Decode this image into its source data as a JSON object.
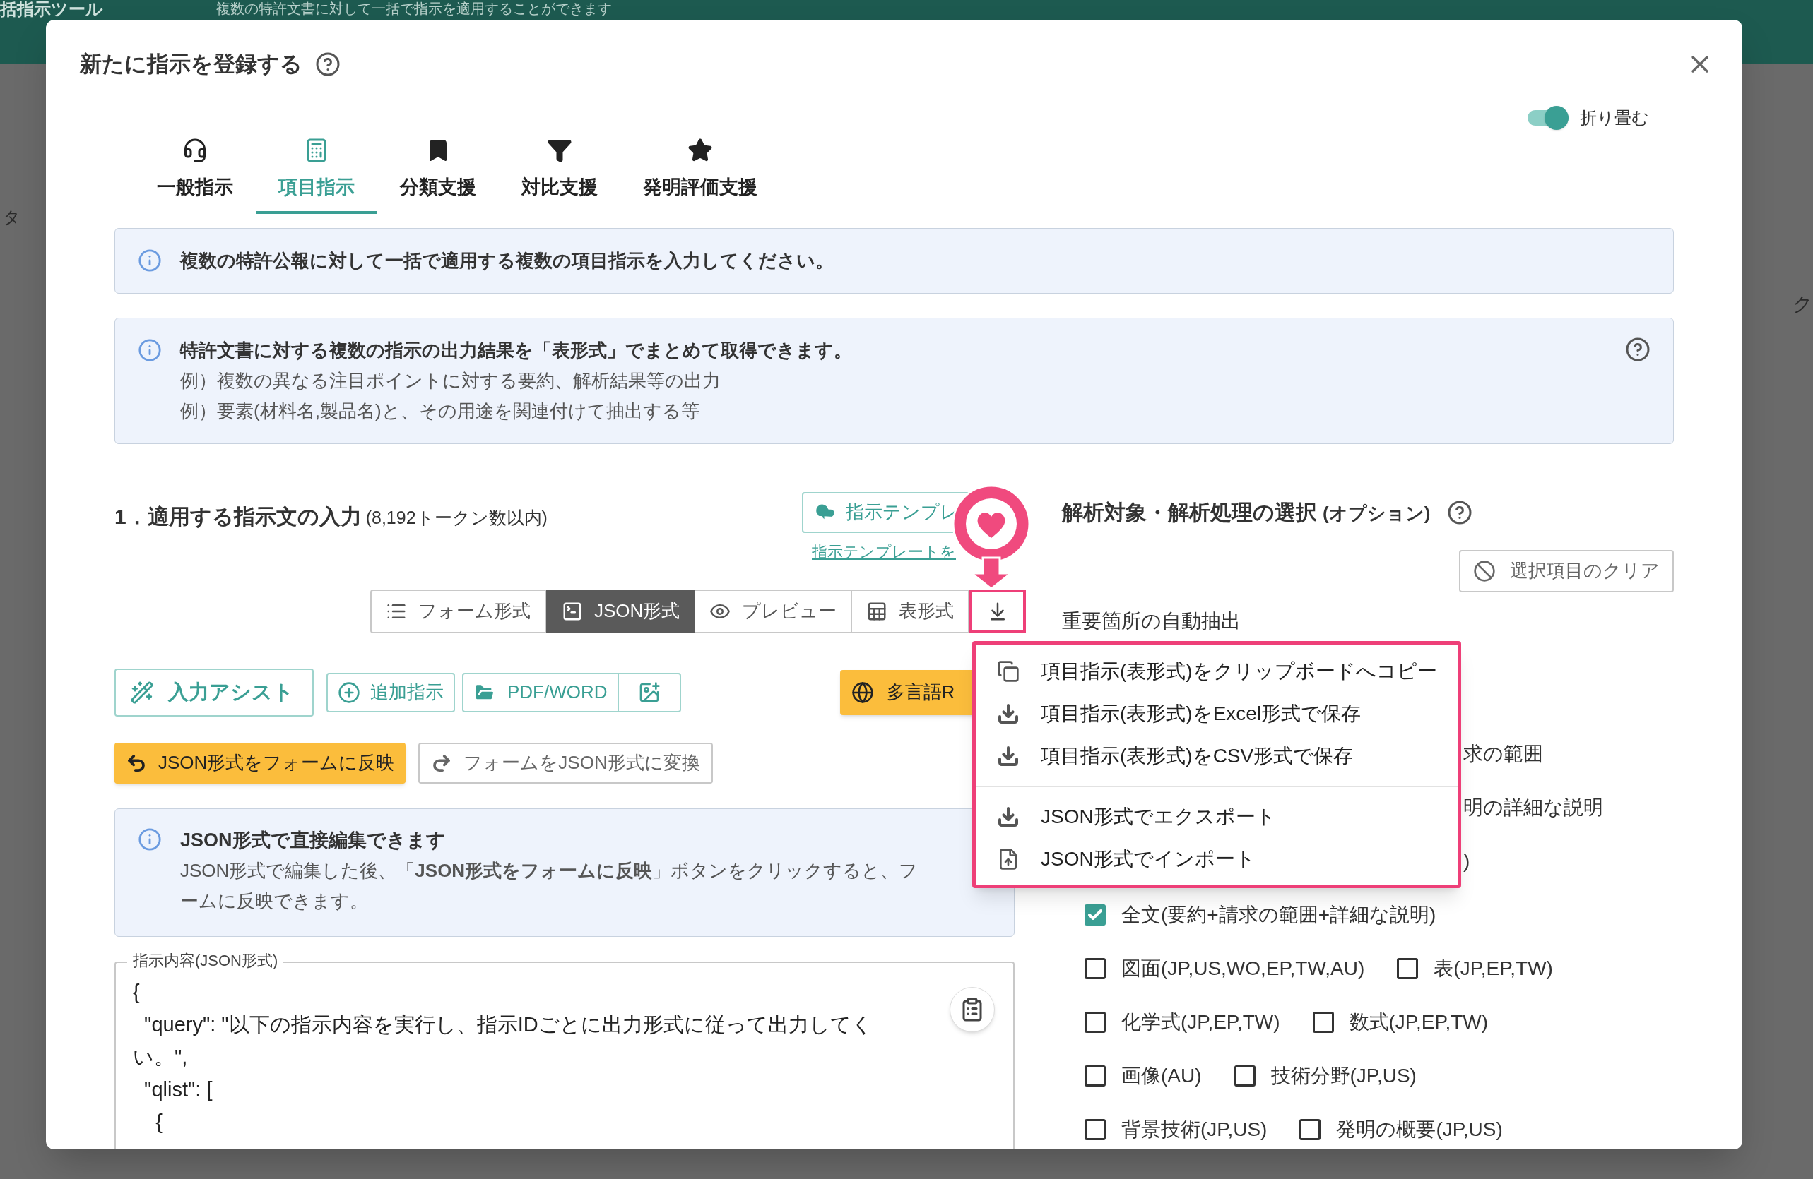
{
  "background": {
    "title": "括指示ツール",
    "subtitle": "複数の特許文書に対して一括で指示を適用することができます",
    "left_label": "タ",
    "right_label": "ク"
  },
  "dialog": {
    "title": "新たに指示を登録する",
    "collapse": {
      "label": "折り畳む",
      "on": true
    }
  },
  "tabs": [
    {
      "label": "一般指示",
      "selected": false
    },
    {
      "label": "項目指示",
      "selected": true
    },
    {
      "label": "分類支援",
      "selected": false
    },
    {
      "label": "対比支援",
      "selected": false
    },
    {
      "label": "発明評価支援",
      "selected": false
    }
  ],
  "notices": [
    {
      "title": "複数の特許公報に対して一括で適用する複数の項目指示を入力してください。",
      "help": false
    },
    {
      "title": "特許文書に対する複数の指示の出力結果を「表形式」でまとめて取得できます。",
      "lines": [
        "例）複数の異なる注目ポイントに対する要約、解析結果等の出力",
        "例）要素(材料名,製品名)と、その用途を関連付けて抽出する等"
      ],
      "help": true
    }
  ],
  "instruction": {
    "heading": "1．適用する指示文の入力",
    "limit": "(8,192トークン数以内)",
    "template_button": "指示テンプレ",
    "template_link": "指示テンプレートを",
    "view_modes": [
      {
        "label": "フォーム形式",
        "selected": false
      },
      {
        "label": "JSON形式",
        "selected": true
      },
      {
        "label": "プレビュー",
        "selected": false
      },
      {
        "label": "表形式",
        "selected": false
      }
    ],
    "assist_button": "入力アシスト",
    "add_button": "追加指示",
    "file_button": "PDF/WORD",
    "language_button": "多言語R",
    "apply_button": "JSON形式をフォームに反映",
    "convert_button": "フォームをJSON形式に変換",
    "json_notice": {
      "title": "JSON形式で直接編集できます",
      "lines": [
        "JSON形式で編集した後、「**JSON形式をフォームに反映**」ボタンをクリックすると、フ",
        "ームに反映できます。"
      ]
    },
    "editor": {
      "legend": "指示内容(JSON形式)",
      "lines": [
        "{",
        "  \"query\": \"以下の指示内容を実行し、指示IDごとに出力形式に従って出力してく",
        "い。\",",
        "  \"qlist\": [",
        "    {"
      ]
    }
  },
  "analysis": {
    "heading": "解析対象・解析処理の選択",
    "heading_note": "(オプション)",
    "clear_button": "選択項目のクリア",
    "section": "重要箇所の自動抽出",
    "rows": [
      {
        "kind": "partial",
        "text": "求の範囲"
      },
      {
        "kind": "partial",
        "text": "明の詳細な説明"
      },
      {
        "kind": "partial",
        "text": ")"
      },
      {
        "kind": "checks",
        "items": [
          {
            "label": "全文(要約+請求の範囲+詳細な説明)",
            "checked": true
          }
        ]
      },
      {
        "kind": "checks",
        "items": [
          {
            "label": "図面(JP,US,WO,EP,TW,AU)",
            "checked": false
          },
          {
            "label": "表(JP,EP,TW)",
            "checked": false
          }
        ]
      },
      {
        "kind": "checks",
        "items": [
          {
            "label": "化学式(JP,EP,TW)",
            "checked": false
          },
          {
            "label": "数式(JP,EP,TW)",
            "checked": false
          }
        ]
      },
      {
        "kind": "checks",
        "items": [
          {
            "label": "画像(AU)",
            "checked": false
          },
          {
            "label": "技術分野(JP,US)",
            "checked": false
          }
        ]
      },
      {
        "kind": "checks",
        "items": [
          {
            "label": "背景技術(JP,US)",
            "checked": false
          },
          {
            "label": "発明の概要(JP,US)",
            "checked": false
          }
        ]
      }
    ]
  },
  "menu": {
    "groups": [
      [
        {
          "kind": "copy",
          "label": "項目指示(表形式)をクリップボードへコピー"
        },
        {
          "kind": "download",
          "label": "項目指示(表形式)をExcel形式で保存"
        },
        {
          "kind": "download",
          "label": "項目指示(表形式)をCSV形式で保存"
        }
      ],
      [
        {
          "kind": "download",
          "label": "JSON形式でエクスポート"
        },
        {
          "kind": "upload",
          "label": "JSON形式でインポート"
        }
      ]
    ]
  }
}
